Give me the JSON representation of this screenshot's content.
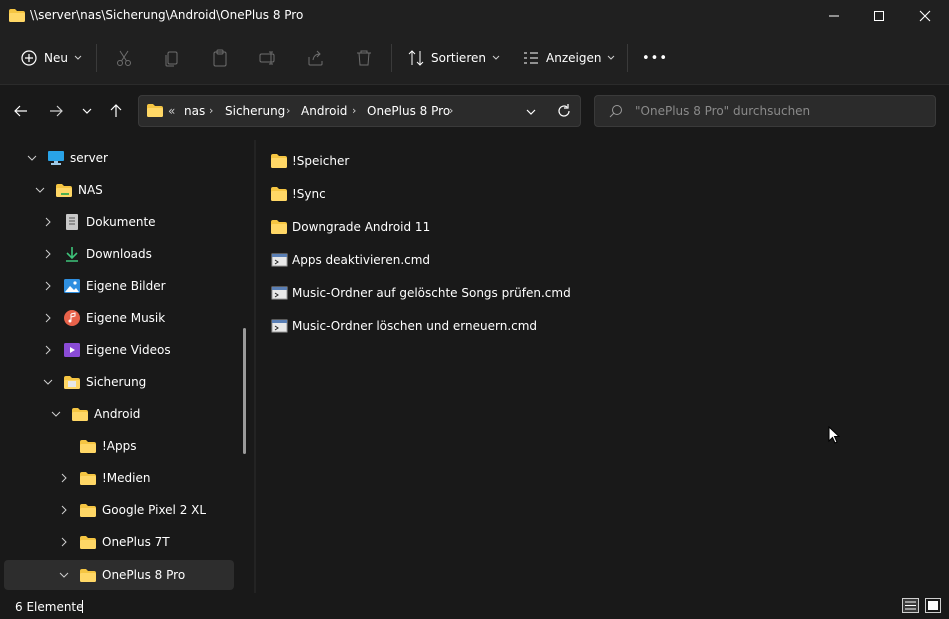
{
  "window": {
    "title": "\\\\server\\nas\\Sicherung\\Android\\OnePlus 8 Pro"
  },
  "toolbar": {
    "new_label": "Neu",
    "sort_label": "Sortieren",
    "view_label": "Anzeigen",
    "more_label": "•••"
  },
  "address": {
    "overflow": "«",
    "crumbs": [
      "nas",
      "Sicherung",
      "Android",
      "OnePlus 8 Pro"
    ]
  },
  "search": {
    "placeholder": "\"OnePlus 8 Pro\" durchsuchen"
  },
  "sidebar": {
    "items": [
      {
        "label": "server"
      },
      {
        "label": "NAS"
      },
      {
        "label": "Dokumente"
      },
      {
        "label": "Downloads"
      },
      {
        "label": "Eigene Bilder"
      },
      {
        "label": "Eigene Musik"
      },
      {
        "label": "Eigene Videos"
      },
      {
        "label": "Sicherung"
      },
      {
        "label": "Android"
      },
      {
        "label": "!Apps"
      },
      {
        "label": "!Medien"
      },
      {
        "label": "Google Pixel 2 XL"
      },
      {
        "label": "OnePlus 7T"
      },
      {
        "label": "OnePlus 8 Pro"
      }
    ]
  },
  "files": [
    {
      "name": "!Speicher",
      "type": "folder"
    },
    {
      "name": "!Sync",
      "type": "folder"
    },
    {
      "name": "Downgrade Android 11",
      "type": "folder"
    },
    {
      "name": "Apps deaktivieren.cmd",
      "type": "cmd"
    },
    {
      "name": "Music-Ordner auf gelöschte Songs prüfen.cmd",
      "type": "cmd"
    },
    {
      "name": "Music-Ordner löschen und erneuern.cmd",
      "type": "cmd"
    }
  ],
  "status": {
    "count": "6 Elemente"
  },
  "colors": {
    "folder": "#f5c542",
    "accent": "#4cc2ff",
    "background": "#191919"
  }
}
